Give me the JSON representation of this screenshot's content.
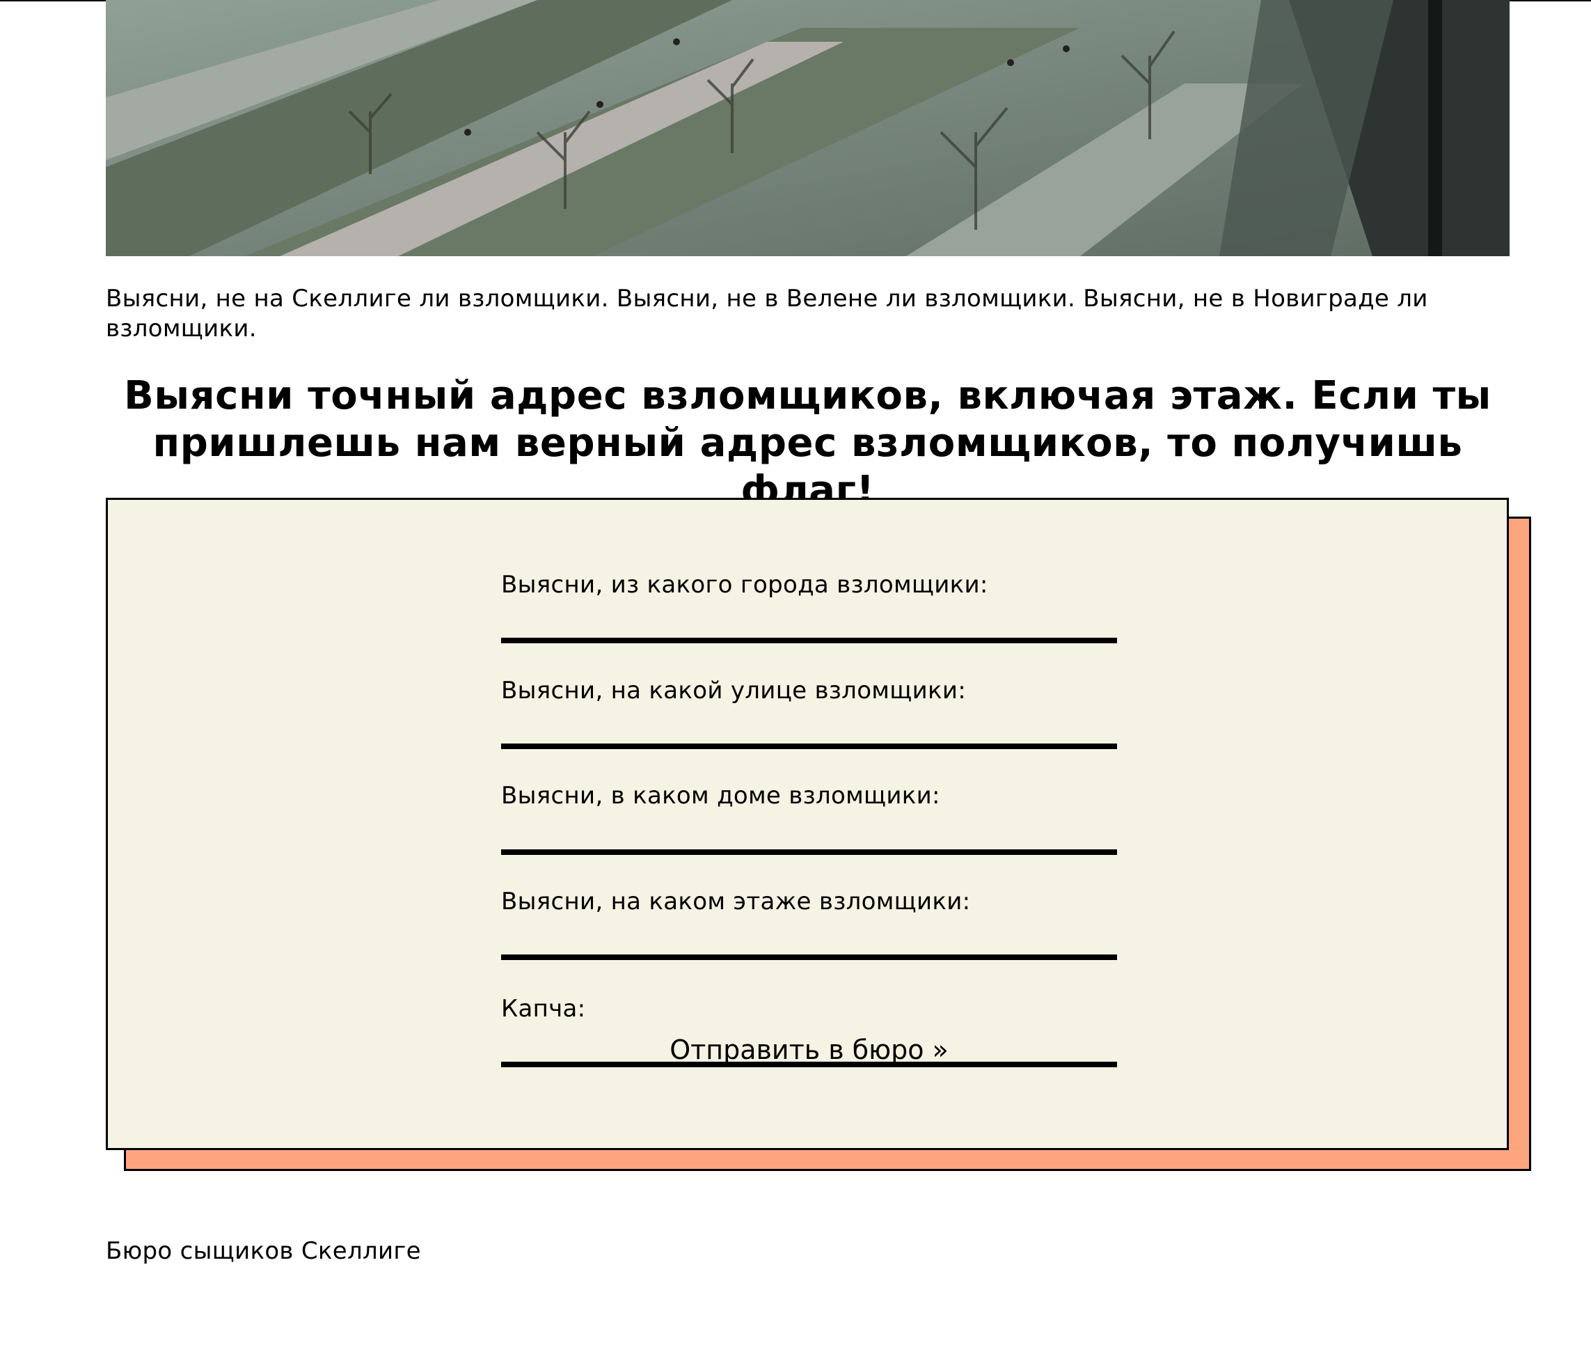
{
  "hero": {
    "image_name": "city-street-window-photo"
  },
  "intro_text": "Выясни, не на Скеллиге ли взломщики. Выясни, не в Велене ли взломщики. Выясни, не в Новиграде ли взломщики.",
  "headline": "Выясни точный адрес взломщиков, включая этаж. Если ты пришлешь нам верный адрес взломщиков, то получишь флаг!",
  "form": {
    "fields": [
      {
        "label": "Выясни, из какого города взломщики:",
        "value": "",
        "placeholder": ""
      },
      {
        "label": "Выясни, на какой улице взломщики:",
        "value": "",
        "placeholder": ""
      },
      {
        "label": "Выясни, в каком доме взломщики:",
        "value": "",
        "placeholder": ""
      },
      {
        "label": "Выясни, на каком этаже взломщики:",
        "value": "",
        "placeholder": ""
      }
    ],
    "captcha_label": "Капча:",
    "submit_label": "Отправить в бюро »"
  },
  "footer": "Бюро сыщиков Скеллиге",
  "colors": {
    "card_background": "#f5f3e3",
    "card_shadow": "#fca57f",
    "border": "#000000"
  }
}
